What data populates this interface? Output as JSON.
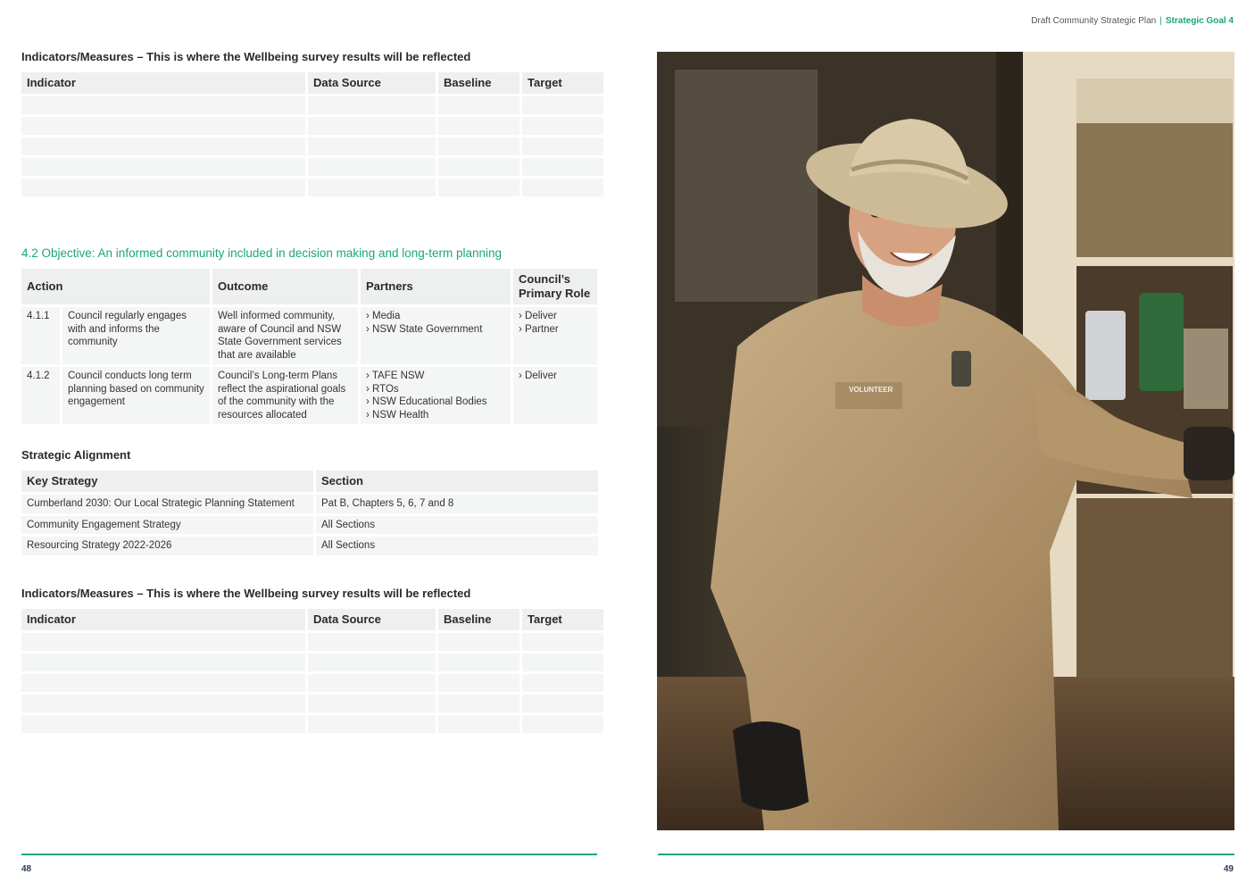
{
  "header": {
    "doc_title": "Draft Community Strategic Plan",
    "separator": "|",
    "goal": "Strategic Goal 4"
  },
  "indicators_1": {
    "heading": "Indicators/Measures – This is where the Wellbeing survey results will be reflected",
    "columns": [
      "Indicator",
      "Data Source",
      "Baseline",
      "Target"
    ]
  },
  "objective": {
    "heading": "4.2 Objective: An informed community included in decision making and long-term planning",
    "columns": [
      "Action",
      "Outcome",
      "Partners",
      "Council’s Primary Role"
    ],
    "rows": [
      {
        "num": "4.1.1",
        "action": "Council regularly engages with and informs the community",
        "outcome": "Well informed community, aware of Council and NSW State Government services that are available",
        "partners": [
          "› Media",
          "› NSW State Government"
        ],
        "roles": [
          "› Deliver",
          "› Partner"
        ]
      },
      {
        "num": "4.1.2",
        "action": "Council conducts long term planning based on community engagement",
        "outcome": "Council’s Long-term Plans reflect the aspirational goals of the community with the resources allocated",
        "partners": [
          "› TAFE NSW",
          "› RTOs",
          "› NSW Educational Bodies",
          "› NSW Health"
        ],
        "roles": [
          "› Deliver"
        ]
      }
    ]
  },
  "alignment": {
    "heading": "Strategic Alignment",
    "columns": [
      "Key Strategy",
      "Section"
    ],
    "rows": [
      [
        "Cumberland 2030: Our Local Strategic Planning Statement",
        "Pat B, Chapters 5, 6, 7 and 8"
      ],
      [
        "Community Engagement Strategy",
        "All Sections"
      ],
      [
        "Resourcing Strategy 2022-2026",
        "All Sections"
      ]
    ]
  },
  "indicators_2": {
    "heading": "Indicators/Measures – This is where the Wellbeing survey results will be reflected",
    "columns": [
      "Indicator",
      "Data Source",
      "Baseline",
      "Target"
    ]
  },
  "photo": {
    "badge_text": "VOLUNTEER"
  },
  "footer": {
    "left_page": "48",
    "right_page": "49"
  },
  "colors": {
    "accent": "#19a77a",
    "table_header": "#eeefef",
    "table_cell": "#f4f5f5"
  }
}
